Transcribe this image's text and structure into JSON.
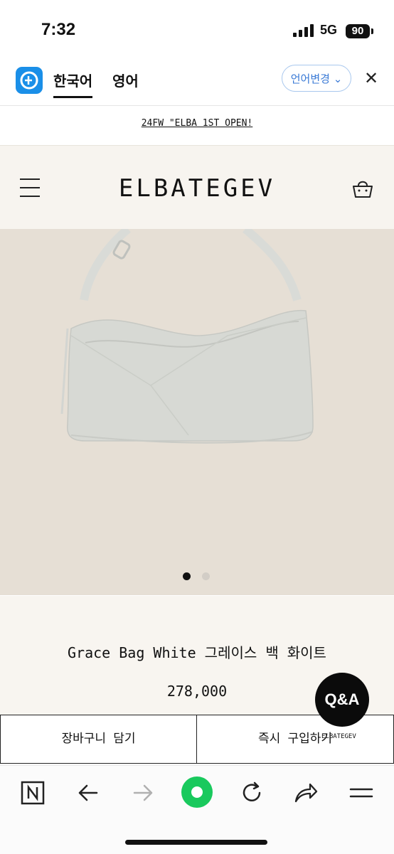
{
  "status_bar": {
    "time": "7:32",
    "network": "5G",
    "battery": "90"
  },
  "translate_bar": {
    "tabs": [
      {
        "label": "한국어",
        "active": true
      },
      {
        "label": "영어",
        "active": false
      }
    ],
    "language_change_label": "언어변경",
    "close_label": "✕",
    "accent_color": "#1a8fe8"
  },
  "announcement": {
    "text": "24FW \"ELBA 1ST OPEN!"
  },
  "header": {
    "brand": "ELBATEGEV",
    "menu_icon": "hamburger-icon",
    "cart_icon": "shopping-bag-icon"
  },
  "product": {
    "name": "Grace Bag White 그레이스 백 화이트",
    "price": "278,000",
    "image_count": 2,
    "active_image_index": 0
  },
  "qa": {
    "label": "Q&A",
    "caption": "ELBATEGEV"
  },
  "actions": {
    "add_to_cart": "장바구니 담기",
    "buy_now": "즉시 구입하기"
  },
  "browser_toolbar": {
    "icons": [
      "naver-n-icon",
      "back-arrow-icon",
      "forward-arrow-icon",
      "green-home-icon",
      "refresh-icon",
      "share-icon",
      "menu-lines-icon"
    ],
    "accent_color": "#19c95d"
  }
}
